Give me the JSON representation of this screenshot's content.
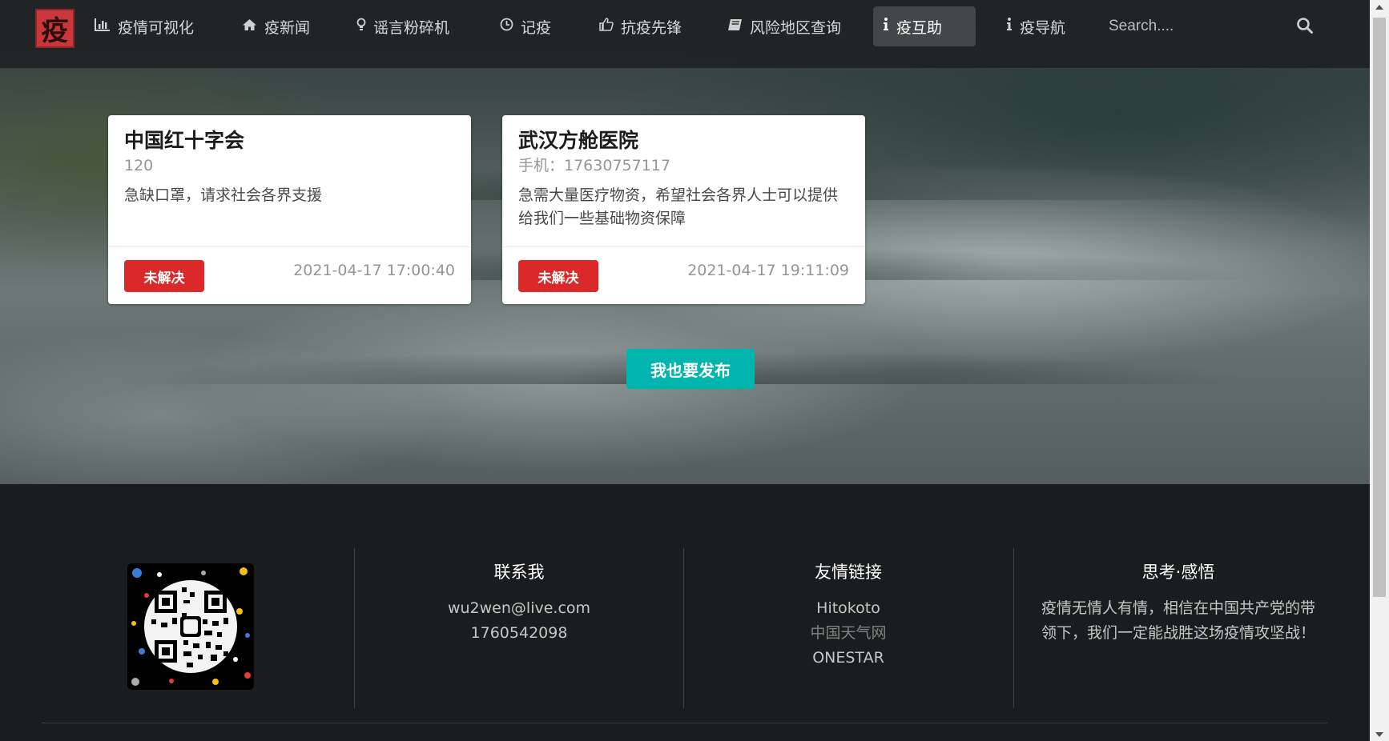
{
  "nav": {
    "logo_glyph": "疫",
    "items": [
      {
        "label": "疫情可视化",
        "icon": "bar-chart-icon"
      },
      {
        "label": "疫新闻",
        "icon": "home-icon"
      },
      {
        "label": "谣言粉碎机",
        "icon": "lightbulb-icon"
      },
      {
        "label": "记疫",
        "icon": "clock-icon"
      },
      {
        "label": "抗疫先锋",
        "icon": "thumbs-up-icon"
      },
      {
        "label": "风险地区查询",
        "icon": "book-icon"
      },
      {
        "label": "疫互助",
        "icon": "info-icon",
        "active": true
      },
      {
        "label": "疫导航",
        "icon": "info-icon"
      }
    ],
    "search_placeholder": "Search...."
  },
  "cards": [
    {
      "title": "中国红十字会",
      "contact": "120",
      "description": "急缺口罩，请求社会各界支援",
      "status": "未解决",
      "time": "2021-04-17 17:00:40"
    },
    {
      "title": "武汉方舱医院",
      "contact": "手机：17630757117",
      "description": "急需大量医疗物资，希望社会各界人士可以提供给我们一些基础物资保障",
      "status": "未解决",
      "time": "2021-04-17 19:11:09"
    }
  ],
  "publish_label": "我也要发布",
  "footer": {
    "contact": {
      "heading": "联系我",
      "email": "wu2wen@live.com",
      "phone": "1760542098"
    },
    "links": {
      "heading": "友情链接",
      "items": [
        "Hitokoto",
        "中国天气网",
        "ONESTAR"
      ]
    },
    "thoughts": {
      "heading": "思考·感悟",
      "text": "疫情无情人有情，相信在中国共产党的带领下，我们一定能战胜这场疫情攻坚战！"
    }
  },
  "colors": {
    "status_red": "#db2828",
    "publish_teal": "#00b5ad",
    "footer_bg": "#1b1c1d"
  }
}
